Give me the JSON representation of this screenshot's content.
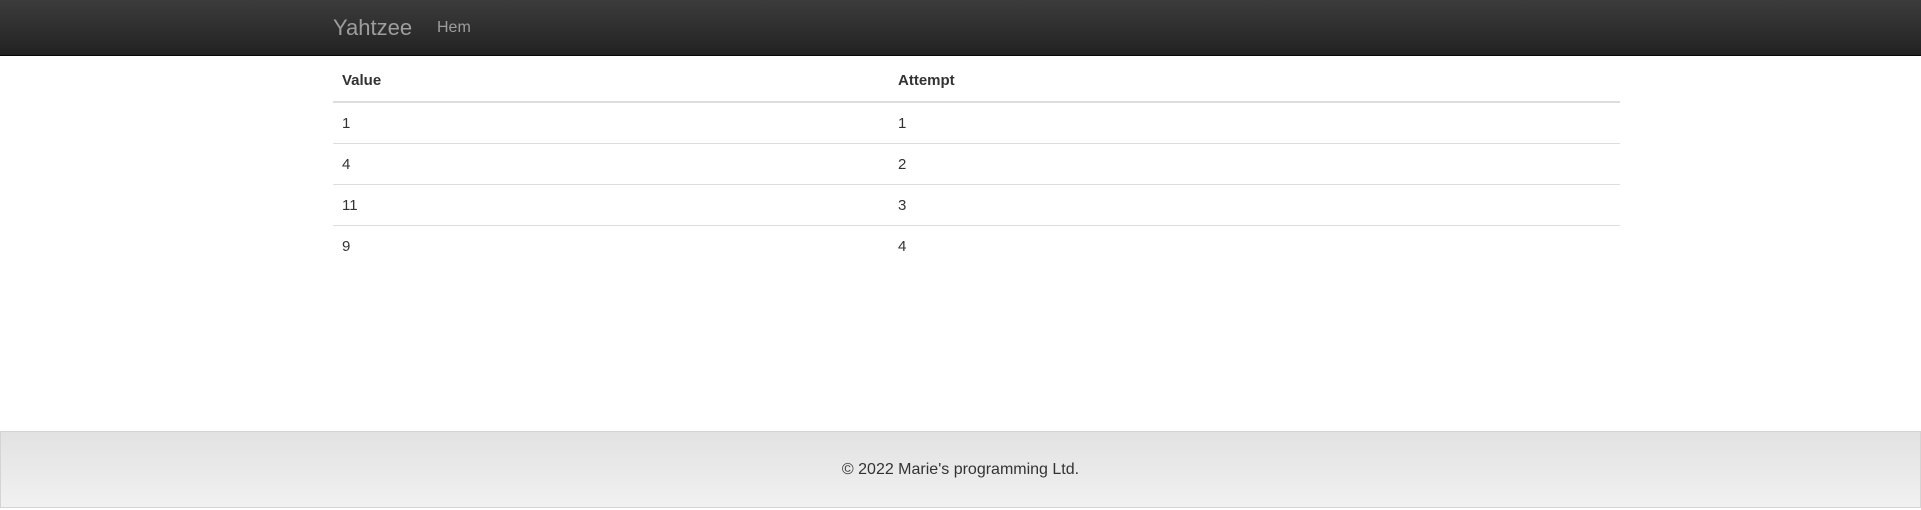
{
  "navbar": {
    "brand": "Yahtzee",
    "links": [
      {
        "label": "Hem"
      }
    ]
  },
  "table": {
    "headers": [
      "Value",
      "Attempt"
    ],
    "rows": [
      [
        "1",
        "1"
      ],
      [
        "4",
        "2"
      ],
      [
        "11",
        "3"
      ],
      [
        "9",
        "4"
      ]
    ]
  },
  "footer": {
    "text": "© 2022 Marie's programming Ltd."
  }
}
